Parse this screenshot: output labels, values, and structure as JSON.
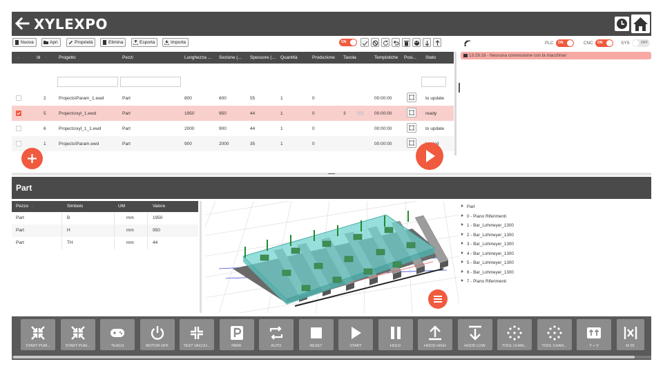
{
  "app": {
    "title": "XYLEXPO"
  },
  "toolbar": {
    "buttons": [
      "Nuova",
      "Apri",
      "Proprietà",
      "Elimina",
      "Esporta",
      "Importa"
    ],
    "toggle_label": "ON"
  },
  "table": {
    "columns": [
      "Id",
      "Progetto",
      "Pezzi",
      "Lunghezza ...",
      "Sezione (...",
      "Spessore (...",
      "Quantità",
      "Produzione",
      "Tavola",
      "Tempistiche",
      "Posi...",
      "Stato"
    ],
    "rows": [
      {
        "id": "2",
        "progetto": "Projects\\Param_1.ewd",
        "pezzi": "Part",
        "lunghezza": "800",
        "sezione": "600",
        "spessore": "55",
        "quantita": "1",
        "produzione": "0",
        "tavola": "",
        "tempistiche": "00:00:00",
        "stato": "to update",
        "checked": false,
        "selected": false
      },
      {
        "id": "5",
        "progetto": "Projects\\xyl_1.ewd",
        "pezzi": "Part",
        "lunghezza": "1950",
        "sezione": "950",
        "spessore": "44",
        "quantita": "1",
        "produzione": "0",
        "tavola": "3",
        "tempistiche": "00:00:00",
        "stato": "ready",
        "checked": true,
        "selected": true
      },
      {
        "id": "6",
        "progetto": "Projects\\xyl_1_1.ewd",
        "pezzi": "Part",
        "lunghezza": "2000",
        "sezione": "900",
        "spessore": "44",
        "quantita": "1",
        "produzione": "0",
        "tavola": "",
        "tempistiche": "00:00:00",
        "stato": "to update",
        "checked": false,
        "selected": false
      },
      {
        "id": "1",
        "progetto": "Projects\\Param.ewd",
        "pezzi": "Part",
        "lunghezza": "900",
        "sezione": "2000",
        "spessore": "35",
        "quantita": "1",
        "produzione": "0",
        "tavola": "",
        "tempistiche": "00:00:00",
        "stato": "loaded",
        "checked": false,
        "selected": false
      }
    ]
  },
  "status": {
    "plc_label": "PLC",
    "plc_toggle": "ON",
    "cnc_label": "CNC",
    "cnc_toggle": "ON",
    "sys_label": "SYS",
    "sys_toggle": "OFF",
    "log_message": "13:29:16 - Nessuna connessione con la macchina!"
  },
  "part": {
    "title": "Part",
    "columns": [
      "Pezzo",
      "Simbolo",
      "UM",
      "Valore"
    ],
    "rows": [
      {
        "pezzo": "Part",
        "simbolo": "B",
        "um": "mm",
        "valore": "1950"
      },
      {
        "pezzo": "Part",
        "simbolo": "H",
        "um": "mm",
        "valore": "950"
      },
      {
        "pezzo": "Part",
        "simbolo": "TH",
        "um": "mm",
        "valore": "44"
      }
    ]
  },
  "tree": {
    "items": [
      "Part",
      "0 - Piano Riferimenti",
      "1 - Bar_Lohmeyer_1300",
      "2 - Bar_Lohmeyer_1300",
      "3 - Bar_Lohmeyer_1300",
      "4 - Bar_Lohmeyer_1300",
      "5 - Bar_Lohmeyer_1300",
      "6 - Bar_Lohmeyer_1300",
      "7 - Piano Riferimenti"
    ]
  },
  "commands": [
    "START PUM...",
    "START PUM...",
    "TEACH",
    "MOTOR OFF",
    "TEST VACUU...",
    "PARK",
    "AUTO",
    "RESET",
    "START",
    "HOLD",
    "HOOD HIGH",
    "HOOD LOW",
    "TOOL CHAN...",
    "TOOL CHAN...",
    "Y + V",
    "M 25"
  ],
  "colors": {
    "accent": "#f05a3e",
    "header": "#4a4a4a",
    "selected_row": "#f9cfcc",
    "button": "#8c8c8c"
  }
}
